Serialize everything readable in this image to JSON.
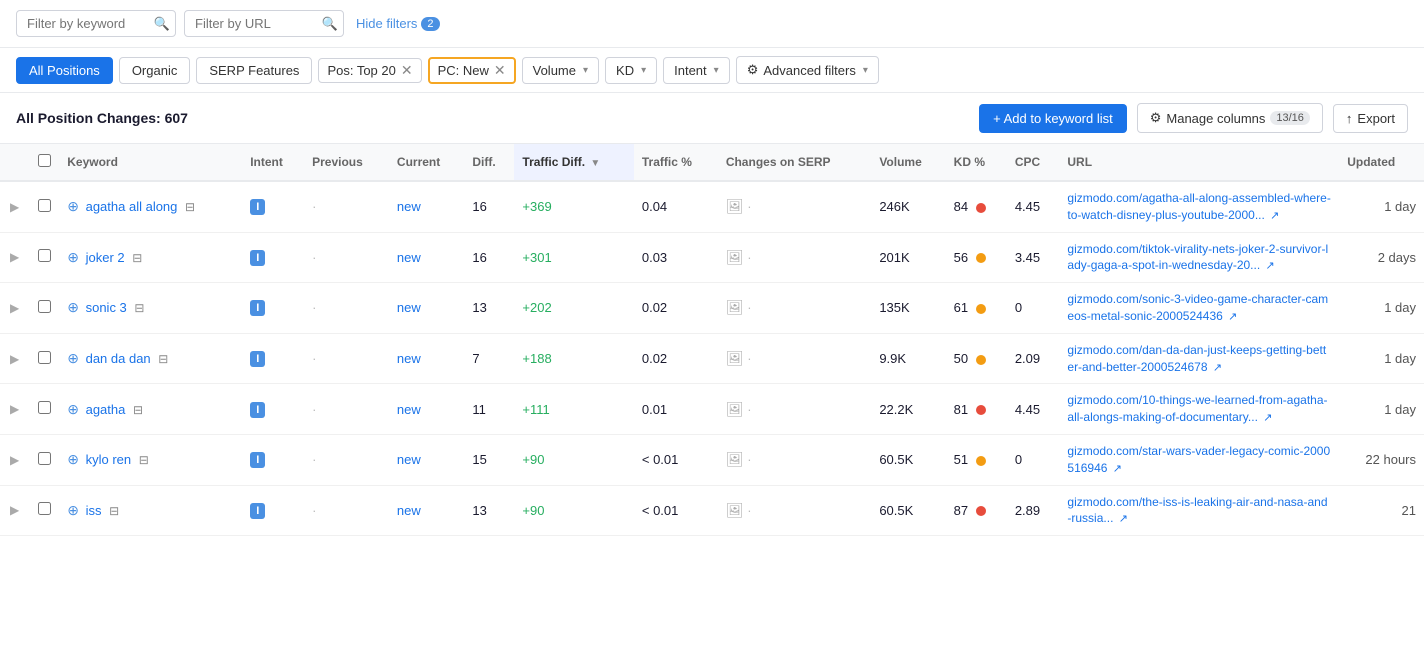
{
  "filters": {
    "keyword_placeholder": "Filter by keyword",
    "url_placeholder": "Filter by URL",
    "hide_filters_label": "Hide filters",
    "filter_count": "2"
  },
  "tabs": [
    {
      "id": "all_positions",
      "label": "All Positions",
      "active": true
    },
    {
      "id": "organic",
      "label": "Organic",
      "active": false
    },
    {
      "id": "serp_features",
      "label": "SERP Features",
      "active": false
    }
  ],
  "active_filters": [
    {
      "id": "pos_top20",
      "label": "Pos: Top 20",
      "highlighted": false
    },
    {
      "id": "pc_new",
      "label": "PC: New",
      "highlighted": true
    }
  ],
  "dropdowns": [
    {
      "id": "volume",
      "label": "Volume"
    },
    {
      "id": "kd",
      "label": "KD"
    },
    {
      "id": "intent",
      "label": "Intent"
    }
  ],
  "advanced_filters_label": "Advanced filters",
  "table": {
    "title": "All Position Changes:",
    "count": "607",
    "add_btn": "+ Add to keyword list",
    "manage_cols_label": "Manage columns",
    "manage_cols_count": "13/16",
    "export_label": "Export",
    "columns": [
      "",
      "",
      "Keyword",
      "Intent",
      "Previous",
      "Current",
      "Diff.",
      "Traffic Diff.",
      "Traffic %",
      "Changes on SERP",
      "Volume",
      "KD %",
      "CPC",
      "URL",
      "Updated"
    ],
    "rows": [
      {
        "keyword": "agatha all along",
        "intent": "I",
        "previous": "·",
        "current": "new",
        "diff": "16",
        "traffic_diff": "+369",
        "traffic_pct": "0.04",
        "changes_serp": "·",
        "volume": "246K",
        "kd": "84",
        "kd_color": "#e74c3c",
        "cpc": "4.45",
        "url": "gizmodo.com/agatha-all-along-assembled-where-to-watch-disney-plus-youtube-2000...",
        "updated": "1 day",
        "has_folder": true
      },
      {
        "keyword": "joker 2",
        "intent": "I",
        "previous": "·",
        "current": "new",
        "diff": "16",
        "traffic_diff": "+301",
        "traffic_pct": "0.03",
        "changes_serp": "·",
        "volume": "201K",
        "kd": "56",
        "kd_color": "#f39c12",
        "cpc": "3.45",
        "url": "gizmodo.com/tiktok-virality-nets-joker-2-survivor-lady-gaga-a-spot-in-wednesday-20...",
        "updated": "2 days",
        "has_folder": true
      },
      {
        "keyword": "sonic 3",
        "intent": "I",
        "previous": "·",
        "current": "new",
        "diff": "13",
        "traffic_diff": "+202",
        "traffic_pct": "0.02",
        "changes_serp": "·",
        "volume": "135K",
        "kd": "61",
        "kd_color": "#f39c12",
        "cpc": "0",
        "url": "gizmodo.com/sonic-3-video-game-character-cameos-metal-sonic-2000524436",
        "updated": "1 day",
        "has_folder": true
      },
      {
        "keyword": "dan da dan",
        "intent": "I",
        "previous": "·",
        "current": "new",
        "diff": "7",
        "traffic_diff": "+188",
        "traffic_pct": "0.02",
        "changes_serp": "·",
        "volume": "9.9K",
        "kd": "50",
        "kd_color": "#f39c12",
        "cpc": "2.09",
        "url": "gizmodo.com/dan-da-dan-just-keeps-getting-better-and-better-2000524678",
        "updated": "1 day",
        "has_folder": true
      },
      {
        "keyword": "agatha",
        "intent": "I",
        "previous": "·",
        "current": "new",
        "diff": "11",
        "traffic_diff": "+111",
        "traffic_pct": "0.01",
        "changes_serp": "·",
        "volume": "22.2K",
        "kd": "81",
        "kd_color": "#e74c3c",
        "cpc": "4.45",
        "url": "gizmodo.com/10-things-we-learned-from-agatha-all-alongs-making-of-documentary...",
        "updated": "1 day",
        "has_folder": true
      },
      {
        "keyword": "kylo ren",
        "intent": "I",
        "previous": "·",
        "current": "new",
        "diff": "15",
        "traffic_diff": "+90",
        "traffic_pct": "< 0.01",
        "changes_serp": "·",
        "volume": "60.5K",
        "kd": "51",
        "kd_color": "#f39c12",
        "cpc": "0",
        "url": "gizmodo.com/star-wars-vader-legacy-comic-2000516946",
        "updated": "22 hours",
        "has_folder": true
      },
      {
        "keyword": "iss",
        "intent": "I",
        "previous": "·",
        "current": "new",
        "diff": "13",
        "traffic_diff": "+90",
        "traffic_pct": "< 0.01",
        "changes_serp": "·",
        "volume": "60.5K",
        "kd": "87",
        "kd_color": "#e74c3c",
        "cpc": "2.89",
        "url": "gizmodo.com/the-iss-is-leaking-air-and-nasa-and-russia...",
        "updated": "21",
        "has_folder": true
      }
    ]
  }
}
